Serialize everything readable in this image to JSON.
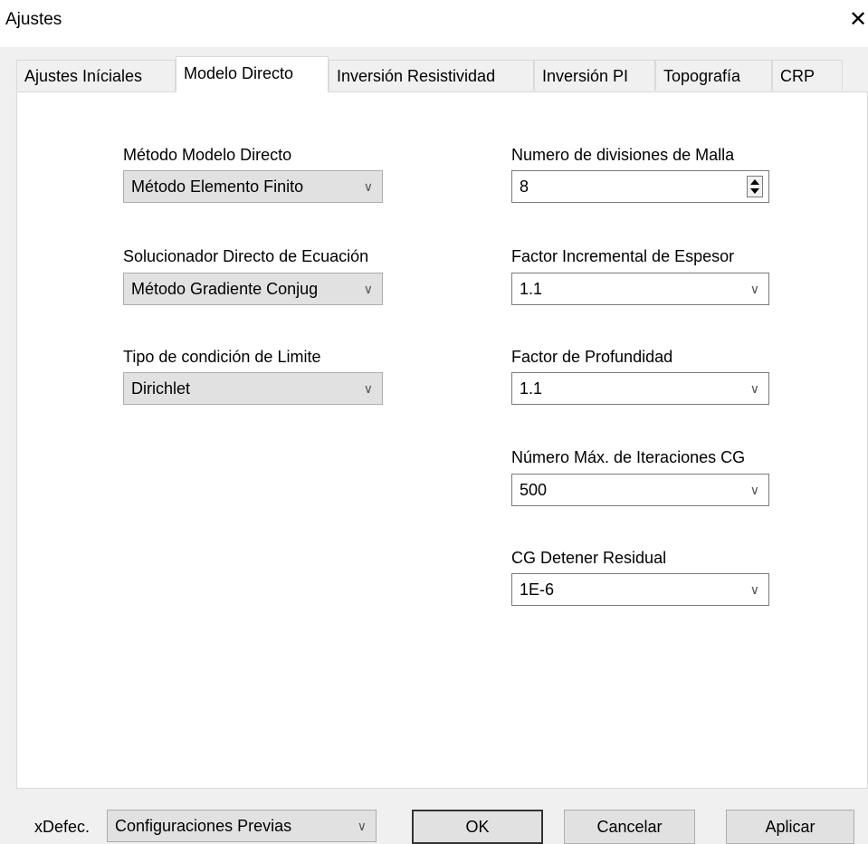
{
  "window": {
    "title": "Ajustes",
    "close_glyph": "✕"
  },
  "tabs": [
    {
      "label": "Ajustes Iníciales"
    },
    {
      "label": "Modelo Directo"
    },
    {
      "label": "Inversión Resistividad"
    },
    {
      "label": "Inversión PI"
    },
    {
      "label": "Topografía"
    },
    {
      "label": "CRP"
    }
  ],
  "active_tab": "Modelo Directo",
  "left": {
    "metodo_label": "Método Modelo Directo",
    "metodo_value": "Método Elemento Finito",
    "solucionador_label": "Solucionador Directo de  Ecuación",
    "solucionador_value": "Método Gradiente Conjug",
    "limite_label": "Tipo de condición de Limite",
    "limite_value": "Dirichlet"
  },
  "right": {
    "divisiones_label": "Numero de divisiones de Malla",
    "divisiones_value": "8",
    "espesor_label": "Factor Incremental de Espesor",
    "espesor_value": "1.1",
    "profundidad_label": "Factor de Profundidad",
    "profundidad_value": "1.1",
    "iteraciones_label": "Número Máx. de Iteraciones CG",
    "iteraciones_value": "500",
    "residual_label": "CG Detener Residual",
    "residual_value": "1E-6"
  },
  "footer": {
    "xdefec_label": "xDefec.",
    "config_value": "Configuraciones Previas",
    "ok_label": "OK",
    "cancel_label": "Cancelar",
    "apply_label": "Aplicar"
  },
  "icons": {
    "dropdown": "chevron-down-icon",
    "spinner": "spinner-icon",
    "close": "close-icon"
  }
}
